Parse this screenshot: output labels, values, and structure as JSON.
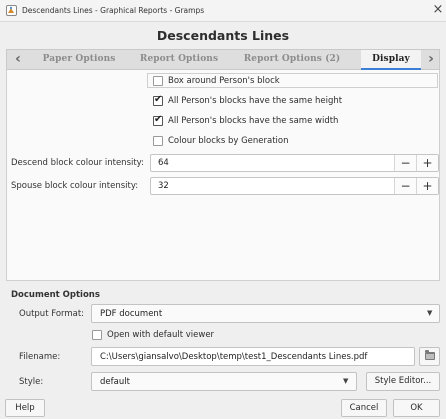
{
  "window": {
    "title": "Descendants Lines - Graphical Reports - Gramps",
    "close_glyph": "×"
  },
  "header": {
    "title": "Descendants Lines"
  },
  "tabs": {
    "items": [
      {
        "label": "Paper Options"
      },
      {
        "label": "Report Options"
      },
      {
        "label": "Report Options (2)"
      },
      {
        "label": "Display"
      }
    ],
    "active": "Display",
    "prev_glyph": "‹",
    "next_glyph": "›"
  },
  "display": {
    "checkboxes": [
      {
        "label": "Box around Person's block",
        "checked": false
      },
      {
        "label": "All Person's blocks have the same height",
        "checked": true
      },
      {
        "label": "All Person's blocks have the same width",
        "checked": true
      },
      {
        "label": "Colour blocks by Generation",
        "checked": false
      }
    ],
    "descend": {
      "label": "Descend block colour intensity:",
      "value": "64"
    },
    "spouse": {
      "label": "Spouse block colour intensity:",
      "value": "32"
    },
    "minus": "−",
    "plus": "+"
  },
  "document": {
    "section_title": "Document Options",
    "output_format_label": "Output Format:",
    "output_format_value": "PDF document",
    "open_default_label": "Open with default viewer",
    "open_default_checked": false,
    "filename_label": "Filename:",
    "filename_value": "C:\\Users\\giansalvo\\Desktop\\temp\\test1_Descendants Lines.pdf",
    "style_label": "Style:",
    "style_value": "default",
    "style_editor": "Style Editor..."
  },
  "footer": {
    "help": "Help",
    "cancel": "Cancel",
    "ok": "OK"
  },
  "colors": {
    "tab_active_underline": "#3b7ed6",
    "background": "#efefef"
  }
}
